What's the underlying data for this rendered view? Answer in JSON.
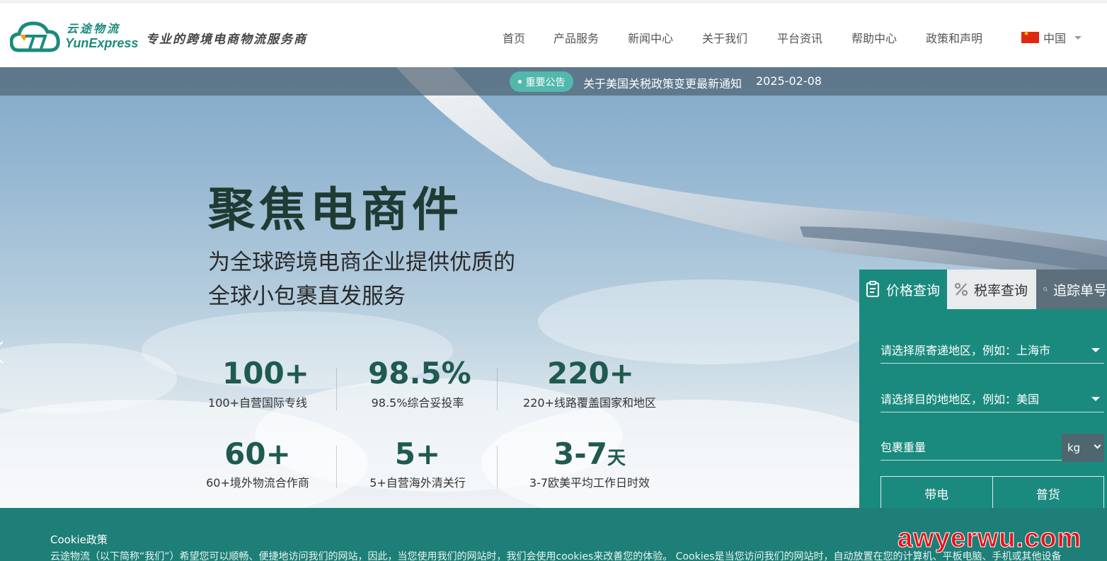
{
  "brand": {
    "name_cn": "云途物流",
    "name_en": "YunExpress",
    "slogan": "专业的跨境电商物流服务商"
  },
  "nav": {
    "items": [
      {
        "label": "首页"
      },
      {
        "label": "产品服务"
      },
      {
        "label": "新闻中心"
      },
      {
        "label": "关于我们"
      },
      {
        "label": "平台资讯"
      },
      {
        "label": "帮助中心"
      },
      {
        "label": "政策和声明"
      }
    ],
    "language": "中国"
  },
  "notice": {
    "badge": "重要公告",
    "text": "关于美国关税政策变更最新通知",
    "date": "2025-02-08"
  },
  "hero": {
    "title": "聚焦电商件",
    "subtitle_line1": "为全球跨境电商企业提供优质的",
    "subtitle_line2": "全球小包裹直发服务",
    "stats": [
      {
        "value": "100+",
        "label": "100+自营国际专线"
      },
      {
        "value": "98.5%",
        "label": "98.5%综合妥投率"
      },
      {
        "value": "220+",
        "label": "220+线路覆盖国家和地区"
      },
      {
        "value": "60+",
        "label": "60+境外物流合作商"
      },
      {
        "value": "5+",
        "label": "5+自营海外清关行"
      },
      {
        "value": "3-7",
        "suffix": "天",
        "label": "3-7欧美平均工作日时效"
      }
    ]
  },
  "quote_panel": {
    "tabs": [
      {
        "label": "价格查询"
      },
      {
        "label": "税率查询"
      },
      {
        "label": "追踪单号"
      }
    ],
    "origin_placeholder": "请选择原寄递地区，例如：上海市",
    "destination_placeholder": "请选择目的地地区，例如：美国",
    "weight_label": "包裹重量",
    "weight_unit": "kg",
    "cargo_types": [
      "带电",
      "普货"
    ]
  },
  "cookie": {
    "title": "Cookie政策",
    "text": "云途物流（以下简称“我们”）希望您可以顺畅、便捷地访问我们的网站，因此，当您使用我们的网站时，我们会使用cookies来改善您的体验。 Cookies是当您访问我们的网站时，自动放置在您的计算机、平板电脑、手机或其他设备"
  },
  "watermark": "awyerwu.com",
  "colors": {
    "brand": "#1b8a7e",
    "notice_badge": "#53b8ac",
    "cookie_bg": "#1d7f77",
    "watermark": "#e8121b"
  }
}
